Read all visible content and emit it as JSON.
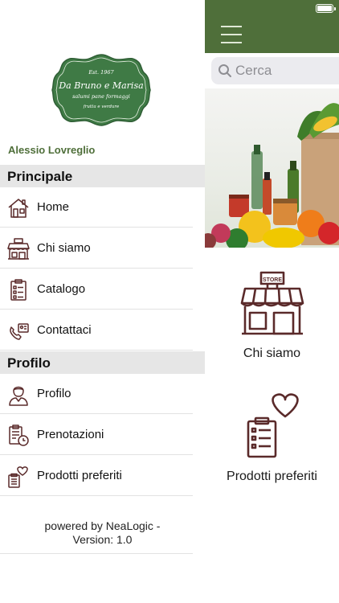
{
  "app": {
    "search": {
      "placeholder": "Cerca"
    },
    "tiles": [
      {
        "label": "Chi siamo",
        "icon": "store-icon"
      },
      {
        "label": "Prodotti preferiti",
        "icon": "favorites-clipboard-icon"
      }
    ],
    "colors": {
      "header": "#4f6f3a",
      "icon_stroke": "#5a2a2a"
    }
  },
  "drawer": {
    "logo": {
      "est": "Est. 1967",
      "name": "Da Bruno e Marisa",
      "tagline": "salumi pane formaggi",
      "tagline2": "frutta e verdure"
    },
    "user_name": "Alessio Lovreglio",
    "sections": [
      {
        "title": "Principale",
        "items": [
          {
            "label": "Home",
            "icon": "home-icon"
          },
          {
            "label": "Chi siamo",
            "icon": "store-icon"
          },
          {
            "label": "Catalogo",
            "icon": "catalog-icon"
          },
          {
            "label": "Contattaci",
            "icon": "contact-phone-icon"
          }
        ]
      },
      {
        "title": "Profilo",
        "items": [
          {
            "label": "Profilo",
            "icon": "user-icon"
          },
          {
            "label": "Prenotazioni",
            "icon": "bookings-icon"
          },
          {
            "label": "Prodotti preferiti",
            "icon": "favorites-icon"
          }
        ]
      }
    ],
    "footer": {
      "line1": "powered by NeaLogic -",
      "line2": "Version: 1.0"
    }
  }
}
